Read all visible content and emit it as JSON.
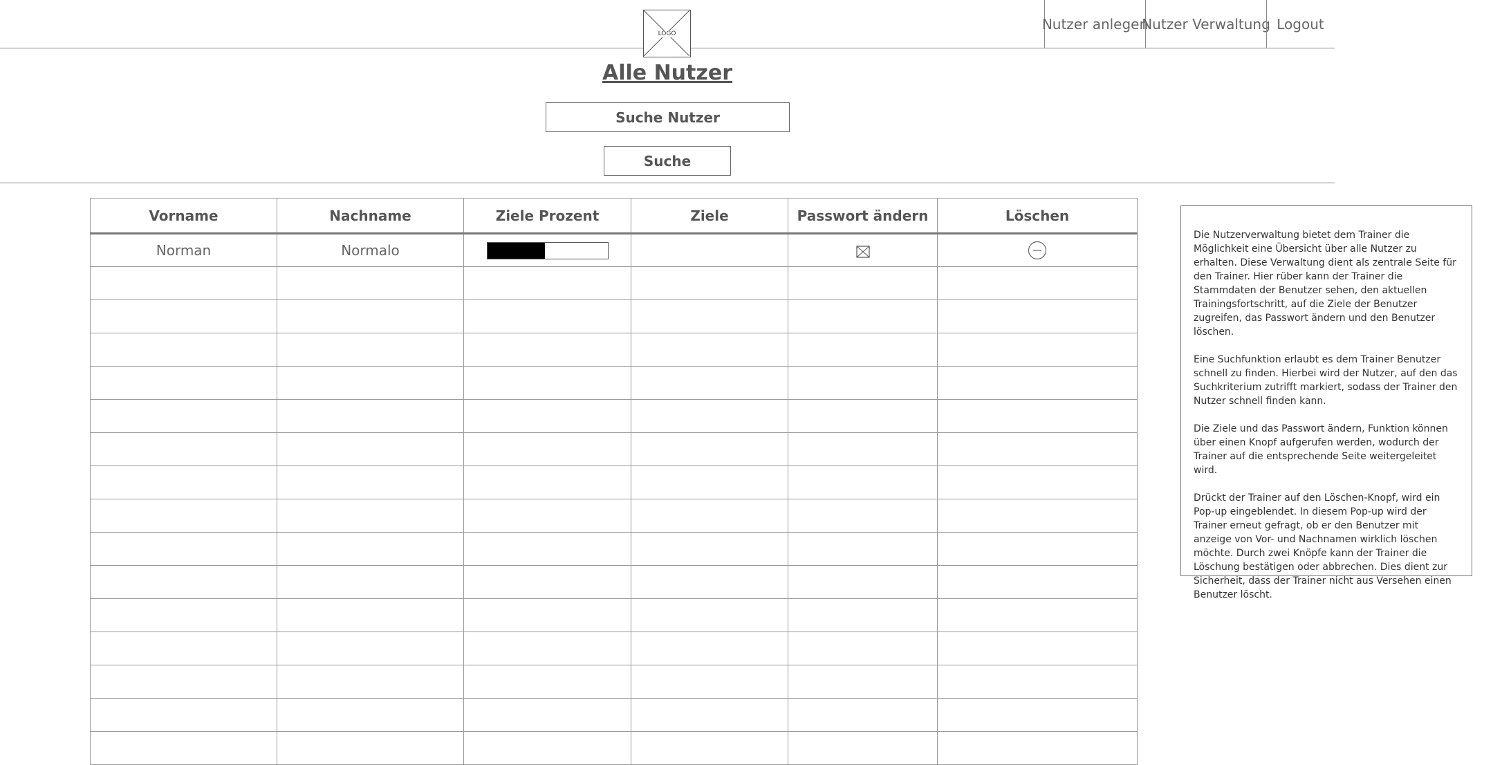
{
  "header": {
    "logo_text": "LOGO",
    "nav": [
      {
        "label": "Nutzer anlegen",
        "name": "nav-nutzer-anlegen"
      },
      {
        "label": "Nutzer Verwaltung",
        "name": "nav-nutzer-verwaltung"
      },
      {
        "label": "Logout",
        "name": "nav-logout"
      }
    ]
  },
  "page": {
    "title": "Alle Nutzer"
  },
  "search": {
    "field_label": "Suche Nutzer",
    "button_label": "Suche"
  },
  "table": {
    "columns": [
      "Vorname",
      "Nachname",
      "Ziele Prozent",
      "Ziele",
      "Passwort ändern",
      "Löschen"
    ],
    "rows": [
      {
        "vorname": "Norman",
        "nachname": "Normalo",
        "ziele_prozent": 0.48,
        "ziele": "",
        "passwort_icon": "envelope-icon",
        "loeschen_icon": "minus-circle-icon"
      }
    ],
    "empty_rows": 15
  },
  "annotation": {
    "paragraphs": [
      "Die Nutzerverwaltung bietet dem Trainer die Möglichkeit eine Übersicht über alle Nutzer zu erhalten. Diese Verwaltung dient als zentrale Seite für den Trainer. Hier rüber kann der Trainer die Stammdaten der Benutzer sehen, den aktuellen Trainingsfortschritt, auf die Ziele der Benutzer zugreifen, das Passwort ändern und den Benutzer löschen.",
      "Eine Suchfunktion erlaubt es dem Trainer Benutzer schnell zu finden. Hierbei wird der Nutzer, auf den das Suchkriterium zutrifft markiert, sodass der Trainer den Nutzer schnell finden kann.",
      "Die Ziele und das Passwort ändern, Funktion können über einen Knopf aufgerufen werden, wodurch der Trainer auf die entsprechende Seite weitergeleitet wird.",
      "Drückt der Trainer auf den Löschen-Knopf, wird ein Pop-up eingeblendet. In diesem Pop-up wird der Trainer erneut gefragt, ob er den Benutzer mit anzeige von Vor- und Nachnamen wirklich löschen möchte. Durch zwei Knöpfe kann der Trainer die Löschung bestätigen oder abbrechen. Dies dient zur Sicherheit, dass der Trainer nicht aus Versehen einen Benutzer löscht."
    ]
  }
}
